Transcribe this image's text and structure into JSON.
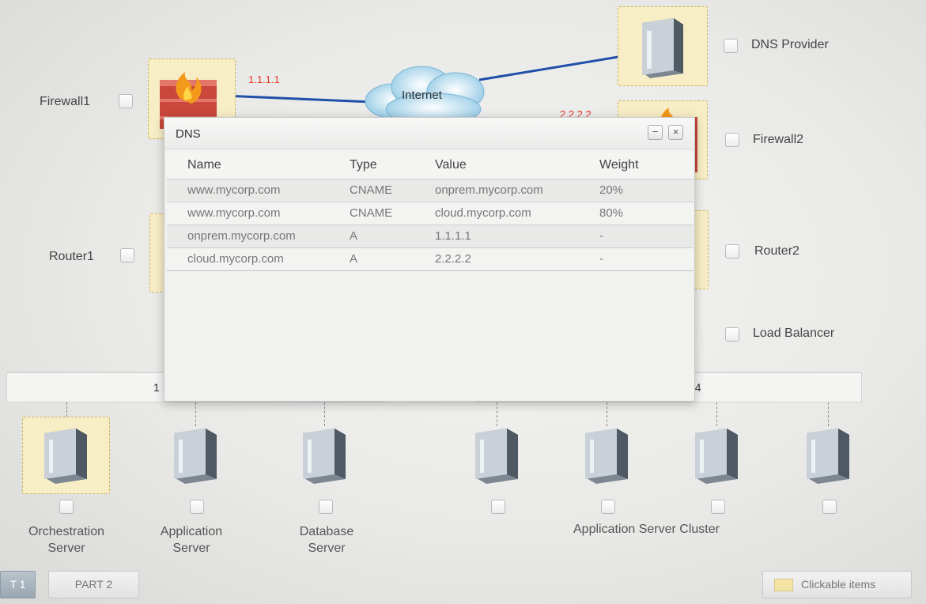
{
  "nodes": {
    "firewall1": {
      "label": "Firewall1",
      "ip": "1.1.1.1"
    },
    "firewall2": {
      "label": "Firewall2",
      "ip": "2.2.2.2"
    },
    "dns_provider": {
      "label": "DNS Provider"
    },
    "router1": {
      "label": "Router1"
    },
    "router2": {
      "label": "Router2"
    },
    "load_balancer": {
      "label": "Load Balancer"
    },
    "internet": {
      "label": "Internet"
    }
  },
  "switches": {
    "left_label": "1",
    "right_label": "24"
  },
  "servers": {
    "orchestration": [
      "Orchestration",
      "Server"
    ],
    "application": [
      "Application",
      "Server"
    ],
    "database": [
      "Database",
      "Server"
    ],
    "cluster_label": "Application Server Cluster"
  },
  "dialog": {
    "title": "DNS",
    "minimize": "−",
    "close": "×",
    "columns": [
      "Name",
      "Type",
      "Value",
      "Weight"
    ],
    "rows": [
      [
        "www.mycorp.com",
        "CNAME",
        "onprem.mycorp.com",
        "20%"
      ],
      [
        "www.mycorp.com",
        "CNAME",
        "cloud.mycorp.com",
        "80%"
      ],
      [
        "onprem.mycorp.com",
        "A",
        "1.1.1.1",
        "-"
      ],
      [
        "cloud.mycorp.com",
        "A",
        "2.2.2.2",
        "-"
      ]
    ]
  },
  "footer": {
    "part1_tab": "T 1",
    "part2_tab": "PART 2",
    "legend": "Clickable items"
  },
  "colors": {
    "ip_label": "#e03a2a",
    "link": "#1f4fa8",
    "tile": "#f7eec6",
    "legend_swatch": "#f3e3a4"
  }
}
